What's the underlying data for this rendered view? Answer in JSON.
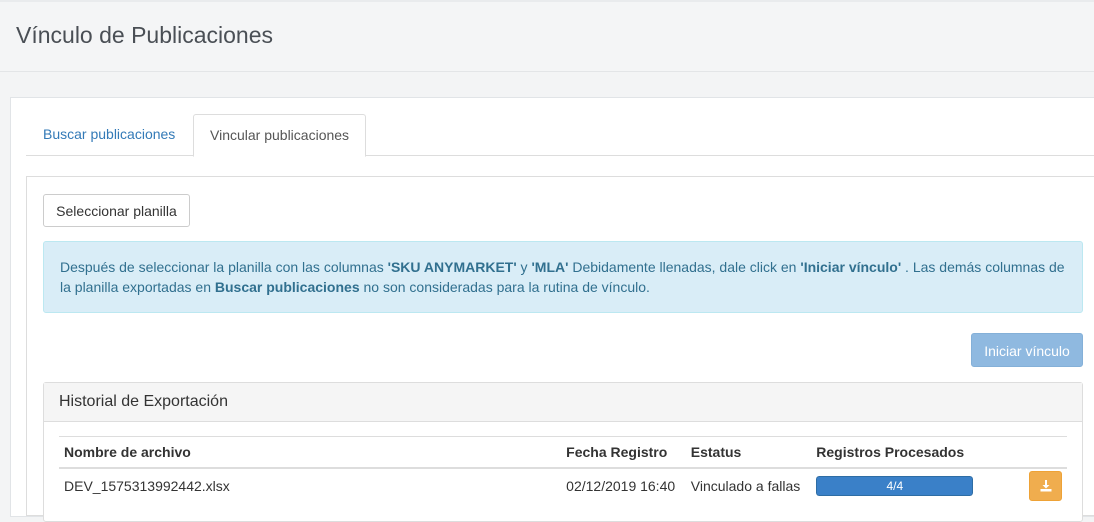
{
  "header": {
    "title": "Vínculo de Publicaciones"
  },
  "tabs": [
    {
      "label": "Buscar publicaciones",
      "active": false
    },
    {
      "label": "Vincular publicaciones",
      "active": true
    }
  ],
  "upload": {
    "select_label": "Seleccionar planilla"
  },
  "info": {
    "part1": "Después de seleccionar la planilla con las columnas ",
    "sku_col": "'SKU ANYMARKET'",
    "part2": " y ",
    "mla_col": "'MLA'",
    "part3": " Debidamente llenadas, dale click en ",
    "action": "'Iniciar vínculo'",
    "part4": " . Las demás columnas de la planilla exportadas en ",
    "search_ref": "Buscar publicaciones",
    "part5": " no son consideradas para la rutina de vínculo."
  },
  "actions": {
    "start_label": "Iniciar vínculo"
  },
  "history": {
    "title": "Historial de Exportación",
    "columns": [
      "Nombre de archivo",
      "Fecha Registro",
      "Estatus",
      "Registros Procesados"
    ],
    "rows": [
      {
        "filename": "DEV_1575313992442.xlsx",
        "date": "02/12/2019 16:40",
        "status": "Vinculado a fallas",
        "processed": "4/4",
        "progress": 1.0
      }
    ]
  },
  "colors": {
    "accent": "#337ab7",
    "info_bg": "#d9edf7",
    "info_text": "#31708f",
    "start_button": "#8fb9e0",
    "download_button": "#f0ad4e",
    "progress": "#3a80c8"
  },
  "icons": {
    "download": "download-icon"
  }
}
